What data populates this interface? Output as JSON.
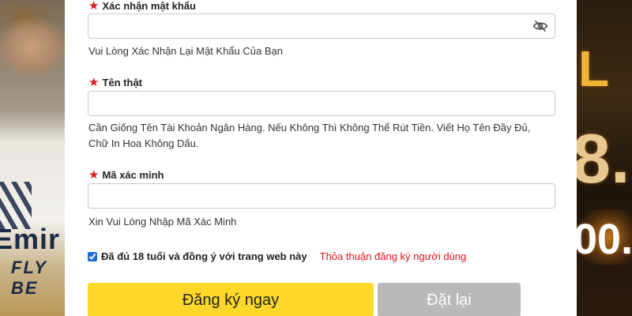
{
  "form": {
    "confirm_password": {
      "label": "Xác nhận mật khẩu",
      "value": "",
      "hint": "Vui Lòng Xác Nhận Lại Mật Khẩu Của Bạn",
      "toggle_icon": "eye-slash-icon"
    },
    "real_name": {
      "label": "Tên thật",
      "value": "",
      "hint_line1": "Cần Giống Tên Tài Khoản Ngân Hàng. Nếu Không Thì Không Thể Rút Tiền. Viết Họ Tên Đầy Đủ,",
      "hint_line2": "Chữ In Hoa Không Dấu."
    },
    "verification_code": {
      "label": "Mã xác minh",
      "value": "",
      "hint": "Xin Vui Lòng Nhập Mã Xác Minh"
    },
    "agreement": {
      "checked": true,
      "text": "Đã đủ 18 tuổi và đồng ý với trang web này",
      "link_text": "Thỏa thuận đăng ký người dùng"
    },
    "buttons": {
      "register": "Đăng ký ngay",
      "reset": "Đặt lại"
    }
  },
  "background": {
    "shirt_brand": "Emir",
    "shirt_sub": "FLY BE",
    "banner_1": "L",
    "banner_2": "8.",
    "banner_3": "00."
  },
  "colors": {
    "required_star": "#e0141c",
    "register_button": "#fdd82a",
    "reset_button": "#b9b9b9",
    "terms_link": "#e0141c"
  }
}
